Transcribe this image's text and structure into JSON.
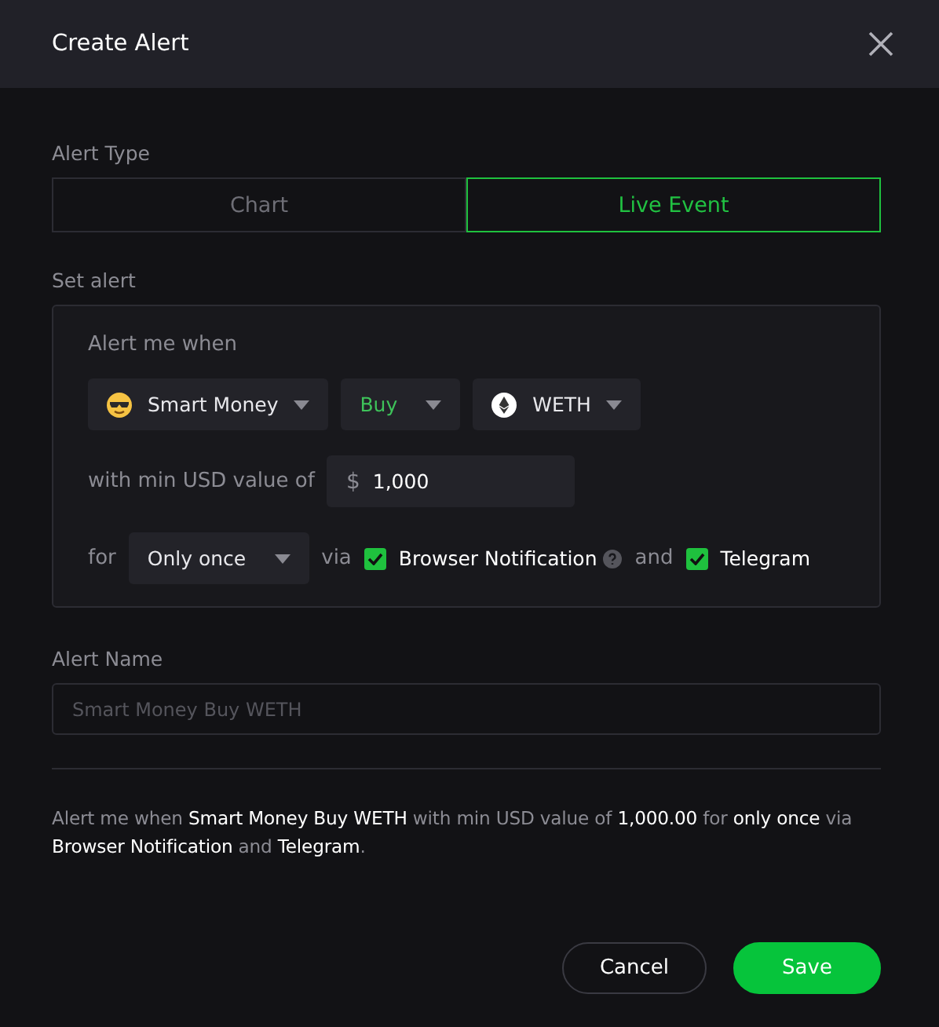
{
  "dialog": {
    "title": "Create Alert"
  },
  "alert_type": {
    "label": "Alert Type",
    "tabs": [
      {
        "label": "Chart",
        "selected": false
      },
      {
        "label": "Live Event",
        "selected": true
      }
    ]
  },
  "set_alert": {
    "label": "Set alert",
    "prompt": "Alert me when",
    "dropdowns": [
      {
        "kind": "emoji",
        "label": "Smart Money"
      },
      {
        "kind": "action",
        "label": "Buy"
      },
      {
        "kind": "token",
        "label": "WETH"
      }
    ],
    "value_label": "with min USD value of",
    "currency": "$",
    "value": "1,000",
    "for_label": "for",
    "frequency": "Only once",
    "via_label": "via",
    "channels": [
      {
        "label": "Browser Notification",
        "checked": true,
        "help": true
      },
      {
        "label": "Telegram",
        "checked": true,
        "help": false
      }
    ],
    "and_label": "and"
  },
  "alert_name": {
    "label": "Alert Name",
    "placeholder": "Smart Money Buy WETH"
  },
  "summary": "Alert me when **Smart Money Buy WETH** with min USD value of **1,000.00** for **only once** via **Browser Notification** and **Telegram**.",
  "buttons": [
    {
      "kind": "secondary",
      "label": "Cancel"
    },
    {
      "kind": "primary",
      "label": "Save"
    }
  ]
}
